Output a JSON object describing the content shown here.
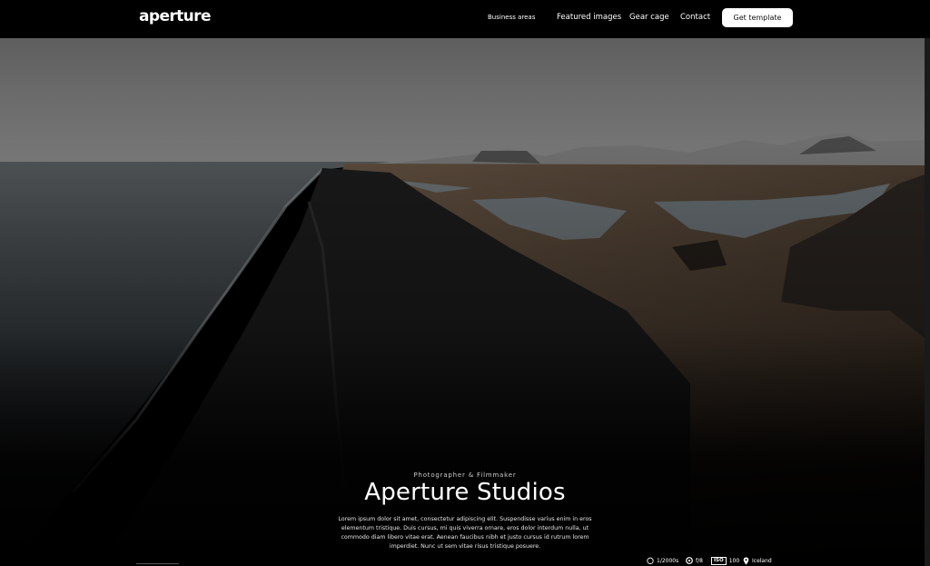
{
  "nav": {
    "logo": "aperture",
    "links": {
      "business_areas": "Business areas",
      "featured_images": "Featured images",
      "gear_cage": "Gear cage",
      "contact": "Contact"
    },
    "cta": "Get template"
  },
  "hero": {
    "eyebrow": "Photographer & Filmmaker",
    "title": "Aperture Studios",
    "description": "Lorem ipsum dolor sit amet, consectetur adipiscing elit. Suspendisse varius enim in eros elementum tristique. Duis cursus, mi quis viverra ornare, eros dolor interdum nulla, ut commodo diam libero vitae erat. Aenean faucibus nibh et justo cursus id rutrum lorem imperdiet. Nunc ut sem vitae risus tristique posuere."
  },
  "exif": {
    "shutter": "1/2000s",
    "aperture": "f/8",
    "iso_label": "ISO",
    "iso_value": "100",
    "location": "Iceland"
  },
  "icons": {
    "shutter": "stopwatch-icon",
    "aperture": "aperture-icon",
    "iso": "iso-badge",
    "location": "map-pin-icon"
  },
  "colors": {
    "background": "#000000",
    "button_bg": "#ffffff",
    "button_text": "#111111"
  }
}
